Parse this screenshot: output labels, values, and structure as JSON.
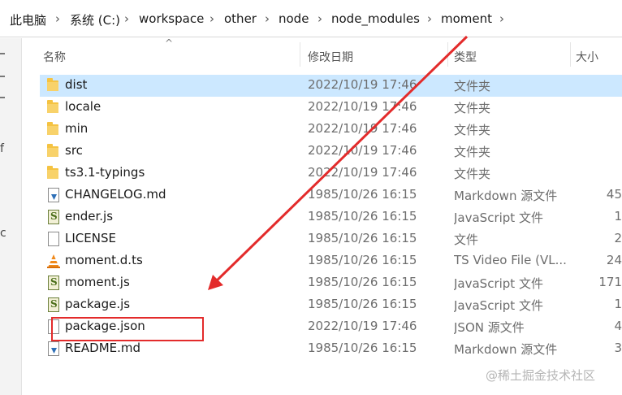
{
  "breadcrumb": {
    "items": [
      "此电脑",
      "系统 (C:)",
      "workspace",
      "other",
      "node",
      "node_modules",
      "moment"
    ],
    "separator": "›"
  },
  "left_pane": {
    "fragments": [
      "f",
      "c"
    ]
  },
  "columns": {
    "name": "名称",
    "modified": "修改日期",
    "type": "类型",
    "size": "大小",
    "sort_indicator": "^"
  },
  "files": [
    {
      "name": "dist",
      "icon": "folder-icon",
      "modified": "2022/10/19 17:46",
      "type": "文件夹",
      "size": "",
      "selected": true
    },
    {
      "name": "locale",
      "icon": "folder-icon",
      "modified": "2022/10/19 17:46",
      "type": "文件夹",
      "size": ""
    },
    {
      "name": "min",
      "icon": "folder-icon",
      "modified": "2022/10/19 17:46",
      "type": "文件夹",
      "size": ""
    },
    {
      "name": "src",
      "icon": "folder-icon",
      "modified": "2022/10/19 17:46",
      "type": "文件夹",
      "size": ""
    },
    {
      "name": "ts3.1-typings",
      "icon": "folder-icon",
      "modified": "2022/10/19 17:46",
      "type": "文件夹",
      "size": ""
    },
    {
      "name": "CHANGELOG.md",
      "icon": "markdown-file-icon",
      "modified": "1985/10/26 16:15",
      "type": "Markdown 源文件",
      "size": "45"
    },
    {
      "name": "ender.js",
      "icon": "javascript-file-icon",
      "modified": "1985/10/26 16:15",
      "type": "JavaScript 文件",
      "size": "1"
    },
    {
      "name": "LICENSE",
      "icon": "blank-file-icon",
      "modified": "1985/10/26 16:15",
      "type": "文件",
      "size": "2"
    },
    {
      "name": "moment.d.ts",
      "icon": "vlc-cone-icon",
      "modified": "1985/10/26 16:15",
      "type": "TS Video File (VL...",
      "size": "24"
    },
    {
      "name": "moment.js",
      "icon": "javascript-file-icon",
      "modified": "1985/10/26 16:15",
      "type": "JavaScript 文件",
      "size": "171"
    },
    {
      "name": "package.js",
      "icon": "javascript-file-icon",
      "modified": "1985/10/26 16:15",
      "type": "JavaScript 文件",
      "size": "1"
    },
    {
      "name": "package.json",
      "icon": "json-file-icon",
      "modified": "2022/10/19 17:46",
      "type": "JSON 源文件",
      "size": "4"
    },
    {
      "name": "README.md",
      "icon": "markdown-file-icon",
      "modified": "1985/10/26 16:15",
      "type": "Markdown 源文件",
      "size": "3"
    }
  ],
  "watermark": "@稀土掘金技术社区",
  "colors": {
    "selection": "#cce8ff",
    "annotation_red": "#e32b2b",
    "folder_yellow": "#f5c342",
    "secondary_text": "#6d6d6d"
  }
}
